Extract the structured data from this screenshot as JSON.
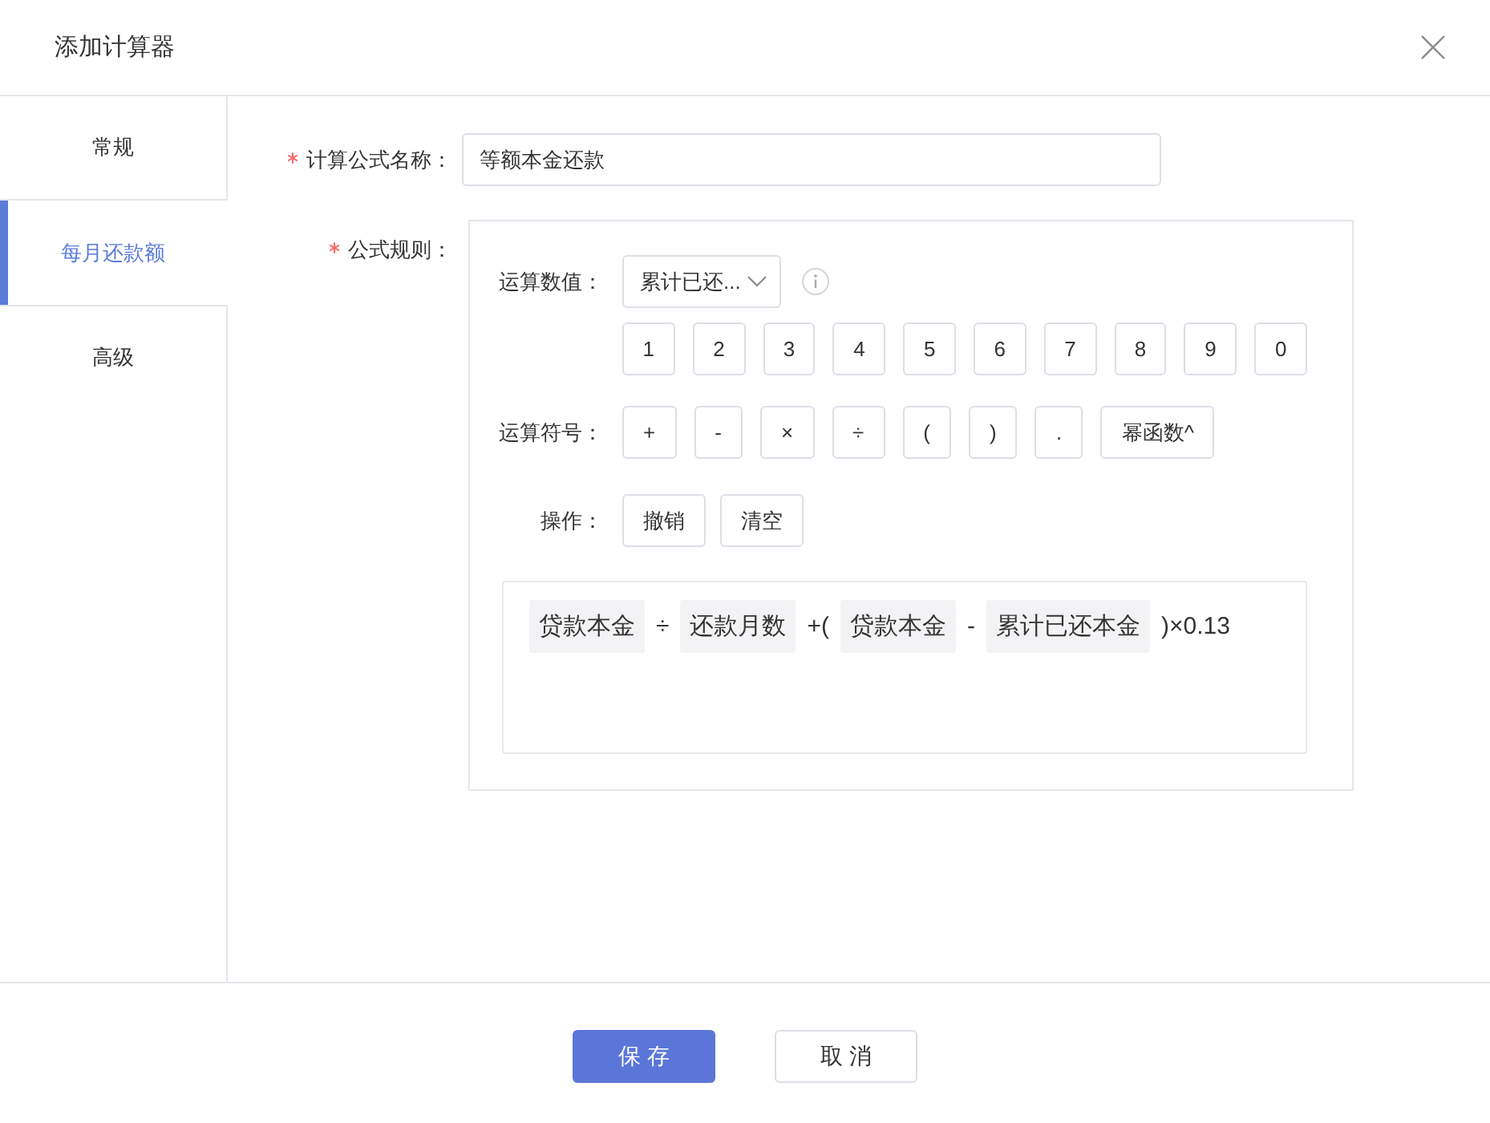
{
  "dialog": {
    "title": "添加计算器"
  },
  "sidebar": {
    "tabs": [
      {
        "label": "常规",
        "selected": false
      },
      {
        "label": "每月还款额",
        "selected": true
      },
      {
        "label": "高级",
        "selected": false
      }
    ]
  },
  "form": {
    "name_field": {
      "label": "计算公式名称：",
      "required": true,
      "value": "等额本金还款"
    },
    "rule": {
      "label": "公式规则：",
      "required": true,
      "value_row": {
        "label": "运算数值：",
        "dropdown": "累计已还..."
      },
      "digits": [
        "1",
        "2",
        "3",
        "4",
        "5",
        "6",
        "7",
        "8",
        "9",
        "0"
      ],
      "operator_row": {
        "label": "运算符号：",
        "operators": [
          "+",
          "-",
          "×",
          "÷",
          "(",
          ")",
          ".",
          "幂函数^"
        ]
      },
      "action_row": {
        "label": "操作：",
        "buttons": [
          "撤销",
          "清空"
        ]
      },
      "formula": [
        {
          "kind": "variable",
          "text": "贷款本金"
        },
        {
          "kind": "symbol",
          "text": "÷"
        },
        {
          "kind": "variable",
          "text": "还款月数"
        },
        {
          "kind": "symbol",
          "text": "+("
        },
        {
          "kind": "variable",
          "text": "贷款本金"
        },
        {
          "kind": "symbol",
          "text": "-"
        },
        {
          "kind": "variable",
          "text": "累计已还本金"
        },
        {
          "kind": "symbol",
          "text": ")×0.13"
        }
      ]
    }
  },
  "footer": {
    "buttons": [
      {
        "label": "保存",
        "kind": "primary"
      },
      {
        "label": "取消",
        "kind": "secondary"
      }
    ]
  }
}
